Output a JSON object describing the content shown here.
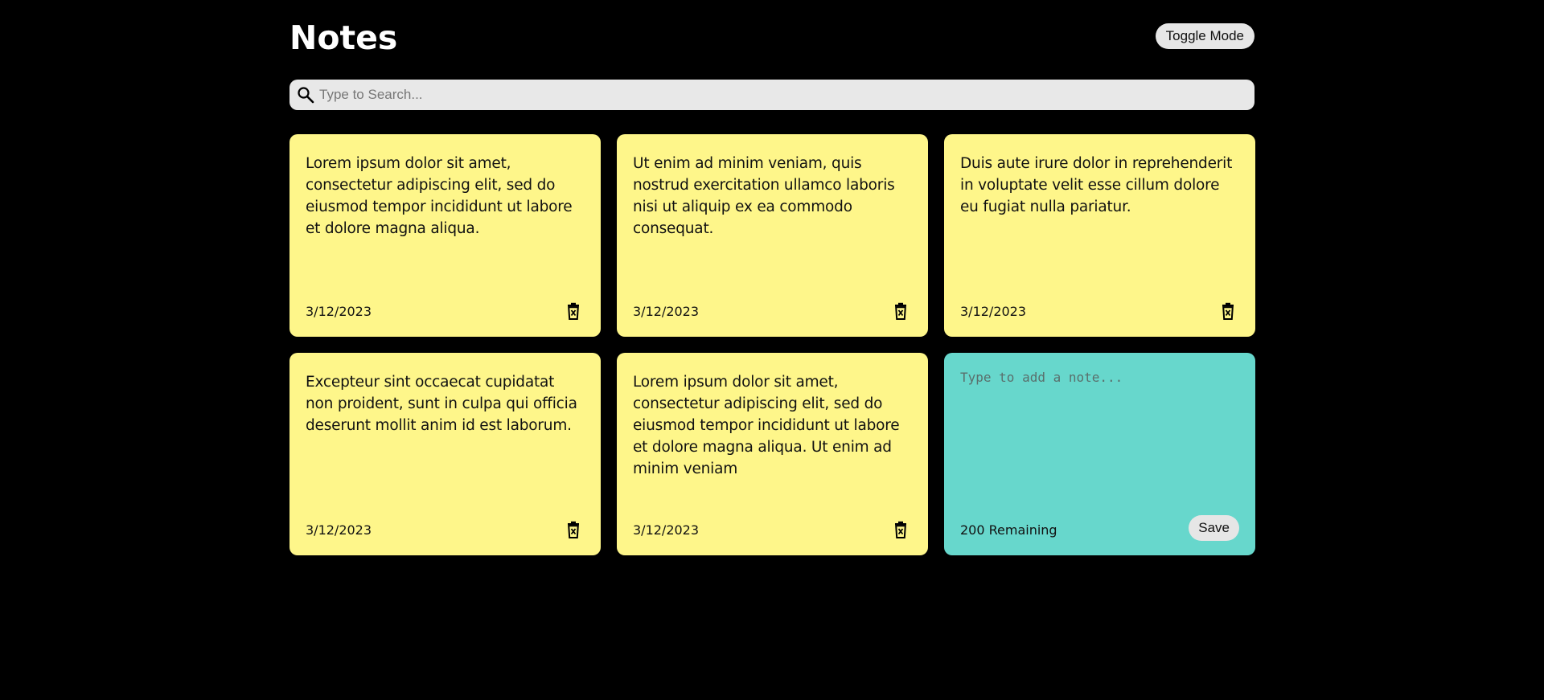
{
  "header": {
    "title": "Notes",
    "toggle_label": "Toggle Mode"
  },
  "search": {
    "placeholder": "Type to Search...",
    "value": "",
    "icon": "search-icon"
  },
  "notes": [
    {
      "text": "Lorem ipsum dolor sit amet, consectetur adipiscing elit, sed do eiusmod tempor incididunt ut labore et dolore magna aliqua.",
      "date": "3/12/2023",
      "icon": "delete-icon"
    },
    {
      "text": "Ut enim ad minim veniam, quis nostrud exercitation ullamco laboris nisi ut aliquip ex ea commodo consequat.",
      "date": "3/12/2023",
      "icon": "delete-icon"
    },
    {
      "text": "Duis aute irure dolor in reprehenderit in voluptate velit esse cillum dolore eu fugiat nulla pariatur.",
      "date": "3/12/2023",
      "icon": "delete-icon"
    },
    {
      "text": "Excepteur sint occaecat cupidatat non proident, sunt in culpa qui officia deserunt mollit anim id est laborum.",
      "date": "3/12/2023",
      "icon": "delete-icon"
    },
    {
      "text": "Lorem ipsum dolor sit amet, consectetur adipiscing elit, sed do eiusmod tempor incididunt ut labore et dolore magna aliqua. Ut enim ad minim veniam",
      "date": "3/12/2023",
      "icon": "delete-icon"
    }
  ],
  "new_note": {
    "placeholder": "Type to add a note...",
    "value": "",
    "remaining": "200 Remaining",
    "save_label": "Save"
  },
  "colors": {
    "background": "#000000",
    "note": "#fef68a",
    "new_note": "#67d7cc",
    "button": "#e6e6e6",
    "search": "#e8e8e8"
  }
}
